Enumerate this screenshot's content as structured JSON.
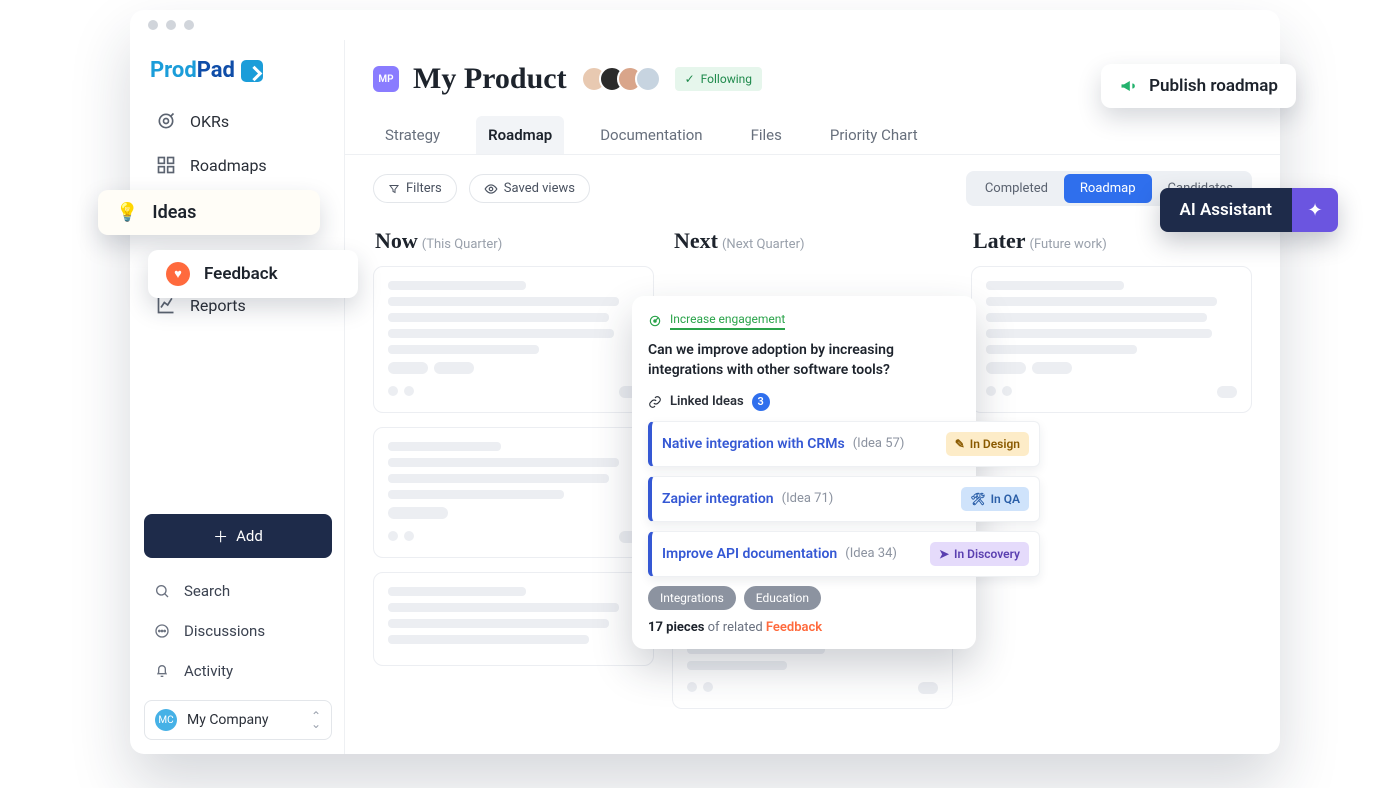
{
  "logo": {
    "prod": "Prod",
    "pad": "Pad"
  },
  "nav": {
    "okrs": "OKRs",
    "roadmaps": "Roadmaps",
    "ideas": "Ideas",
    "feedback": "Feedback",
    "reports": "Reports"
  },
  "addButton": "Add",
  "bottomLinks": {
    "search": "Search",
    "discussions": "Discussions",
    "activity": "Activity"
  },
  "company": {
    "initials": "MC",
    "name": "My Company"
  },
  "product": {
    "badge": "MP",
    "title": "My Product",
    "following": "Following"
  },
  "tabs": {
    "strategy": "Strategy",
    "roadmap": "Roadmap",
    "documentation": "Documentation",
    "files": "Files",
    "priority": "Priority Chart"
  },
  "filters": {
    "filters": "Filters",
    "saved": "Saved views"
  },
  "segments": {
    "completed": "Completed",
    "roadmap": "Roadmap",
    "candidates": "Candidates"
  },
  "columns": {
    "now": {
      "title": "Now",
      "sub": "(This Quarter)"
    },
    "next": {
      "title": "Next",
      "sub": "(Next Quarter)"
    },
    "later": {
      "title": "Later",
      "sub": "(Future work)"
    }
  },
  "publish": "Publish roadmap",
  "ai": "AI Assistant",
  "detail": {
    "objective": "Increase engagement",
    "question": "Can we improve adoption by increasing integrations with other software tools?",
    "linkedLabel": "Linked Ideas",
    "linkedCount": "3",
    "ideas": [
      {
        "title": "Native integration with CRMs",
        "id": "(Idea 57)",
        "status": "In Design"
      },
      {
        "title": "Zapier integration",
        "id": "(Idea 71)",
        "status": "In QA"
      },
      {
        "title": "Improve API documentation",
        "id": "(Idea 34)",
        "status": "In Discovery"
      }
    ],
    "tags": [
      "Integrations",
      "Education"
    ],
    "relatedCount": "17 pieces",
    "relatedMid": " of related ",
    "relatedLink": "Feedback"
  }
}
